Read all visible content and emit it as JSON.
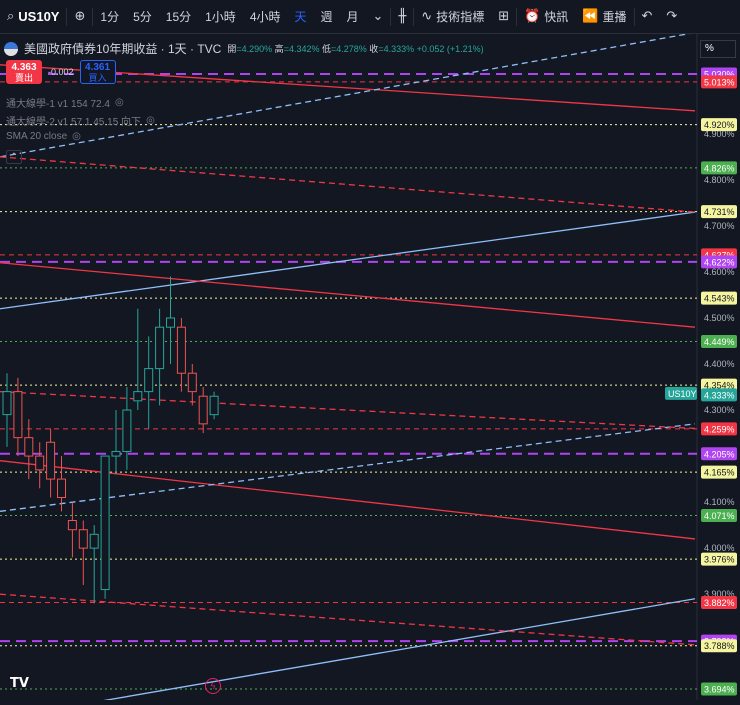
{
  "toolbar": {
    "symbol": "US10Y",
    "intervals": [
      "1分",
      "5分",
      "15分",
      "1小時",
      "4小時",
      "天",
      "週",
      "月"
    ],
    "active_interval": "天",
    "indicators_label": "技術指標",
    "alerts_label": "快訊",
    "replay_label": "重播"
  },
  "legend": {
    "title": "美國政府債券10年期收益 · 1天 · TVC",
    "open_label": "開",
    "open": "=4.290%",
    "high_label": "高",
    "high": "=4.342%",
    "low_label": "低",
    "low": "=4.278%",
    "close_label": "收",
    "close": "=4.333%",
    "change": "+0.052 (+1.21%)"
  },
  "trade": {
    "sell_price": "4.363",
    "sell_label": "賣出",
    "spread": "-0.002",
    "buy_price": "4.361",
    "buy_label": "買入"
  },
  "indicators": [
    {
      "name": "通大線學-1 v1 154 72.4"
    },
    {
      "name": "通大線學-2 v1 57.1 45.15 向下"
    },
    {
      "name": "SMA 20 close"
    }
  ],
  "scale_mode": "%",
  "symbol_tag": "US10Y",
  "colors": {
    "bg": "#131722",
    "up": "#26a69a",
    "down": "#ef5350",
    "red": "#f23645",
    "blue": "#90bff9",
    "purple": "#b044f0",
    "yellow": "#f5f5a0",
    "green": "#4caf50"
  },
  "chart_data": {
    "type": "candlestick",
    "y_range": [
      3.66,
      5.08
    ],
    "y_ticks": [
      "4.900%",
      "4.800%",
      "4.700%",
      "4.600%",
      "4.500%",
      "4.400%",
      "4.300%",
      "4.200%",
      "4.100%",
      "4.000%",
      "3.900%"
    ],
    "h_levels": [
      {
        "label": "5.030%",
        "value": 5.03,
        "color": "#b044f0",
        "bg": "#b044f0",
        "style": "dash-long"
      },
      {
        "label": "5.013%",
        "value": 5.013,
        "color": "#f23645",
        "bg": "#f23645",
        "style": "dash"
      },
      {
        "label": "4.920%",
        "value": 4.92,
        "color": "#f5f5a0",
        "bg": "#f5f5a0",
        "style": "dot"
      },
      {
        "label": "4.826%",
        "value": 4.826,
        "color": "#4caf50",
        "bg": "#4caf50",
        "style": "dot"
      },
      {
        "label": "4.731%",
        "value": 4.731,
        "color": "#f5f5a0",
        "bg": "#f5f5a0",
        "style": "dot"
      },
      {
        "label": "4.637%",
        "value": 4.637,
        "color": "#f23645",
        "bg": "#f23645",
        "style": "dash"
      },
      {
        "label": "4.622%",
        "value": 4.622,
        "color": "#b044f0",
        "bg": "#b044f0",
        "style": "dash-long"
      },
      {
        "label": "4.543%",
        "value": 4.543,
        "color": "#f5f5a0",
        "bg": "#f5f5a0",
        "style": "dot"
      },
      {
        "label": "4.449%",
        "value": 4.449,
        "color": "#4caf50",
        "bg": "#4caf50",
        "style": "dot"
      },
      {
        "label": "4.354%",
        "value": 4.354,
        "color": "#f5f5a0",
        "bg": "#f5f5a0",
        "style": "dot"
      },
      {
        "label": "4.259%",
        "value": 4.259,
        "color": "#f23645",
        "bg": "#f23645",
        "style": "dash"
      },
      {
        "label": "4.205%",
        "value": 4.205,
        "color": "#b044f0",
        "bg": "#b044f0",
        "style": "dash-long"
      },
      {
        "label": "4.165%",
        "value": 4.165,
        "color": "#f5f5a0",
        "bg": "#f5f5a0",
        "style": "dot"
      },
      {
        "label": "4.071%",
        "value": 4.071,
        "color": "#4caf50",
        "bg": "#4caf50",
        "style": "dot"
      },
      {
        "label": "3.976%",
        "value": 3.976,
        "color": "#f5f5a0",
        "bg": "#f5f5a0",
        "style": "dot"
      },
      {
        "label": "3.882%",
        "value": 3.882,
        "color": "#f23645",
        "bg": "#f23645",
        "style": "dash"
      },
      {
        "label": "3.798%",
        "value": 3.798,
        "color": "#b044f0",
        "bg": "#b044f0",
        "style": "dash-long"
      },
      {
        "label": "3.788%",
        "value": 3.788,
        "color": "#f5f5a0",
        "bg": "#f5f5a0",
        "style": "dot"
      },
      {
        "label": "3.694%",
        "value": 3.694,
        "color": "#4caf50",
        "bg": "#4caf50",
        "style": "dot"
      }
    ],
    "current_price": {
      "label": "4.333%",
      "value": 4.333
    },
    "candles": [
      {
        "o": 4.29,
        "h": 4.38,
        "l": 4.22,
        "c": 4.34
      },
      {
        "o": 4.34,
        "h": 4.37,
        "l": 4.2,
        "c": 4.24
      },
      {
        "o": 4.24,
        "h": 4.28,
        "l": 4.15,
        "c": 4.2
      },
      {
        "o": 4.2,
        "h": 4.23,
        "l": 4.13,
        "c": 4.17
      },
      {
        "o": 4.23,
        "h": 4.26,
        "l": 4.11,
        "c": 4.15
      },
      {
        "o": 4.15,
        "h": 4.2,
        "l": 4.08,
        "c": 4.11
      },
      {
        "o": 4.06,
        "h": 4.1,
        "l": 3.98,
        "c": 4.04
      },
      {
        "o": 4.04,
        "h": 4.06,
        "l": 3.92,
        "c": 4.0
      },
      {
        "o": 4.0,
        "h": 4.05,
        "l": 3.88,
        "c": 4.03
      },
      {
        "o": 3.91,
        "h": 4.2,
        "l": 3.89,
        "c": 4.2
      },
      {
        "o": 4.2,
        "h": 4.3,
        "l": 4.16,
        "c": 4.21
      },
      {
        "o": 4.21,
        "h": 4.35,
        "l": 4.17,
        "c": 4.3
      },
      {
        "o": 4.32,
        "h": 4.52,
        "l": 4.3,
        "c": 4.34
      },
      {
        "o": 4.34,
        "h": 4.46,
        "l": 4.26,
        "c": 4.39
      },
      {
        "o": 4.39,
        "h": 4.52,
        "l": 4.31,
        "c": 4.48
      },
      {
        "o": 4.48,
        "h": 4.59,
        "l": 4.4,
        "c": 4.5
      },
      {
        "o": 4.48,
        "h": 4.5,
        "l": 4.34,
        "c": 4.38
      },
      {
        "o": 4.38,
        "h": 4.4,
        "l": 4.31,
        "c": 4.34
      },
      {
        "o": 4.33,
        "h": 4.35,
        "l": 4.25,
        "c": 4.27
      },
      {
        "o": 4.29,
        "h": 4.34,
        "l": 4.28,
        "c": 4.33
      }
    ],
    "trend_lines": [
      {
        "color": "#f23645",
        "style": "solid",
        "p1": [
          0,
          5.05
        ],
        "p2": [
          695,
          4.95
        ]
      },
      {
        "color": "#90bff9",
        "style": "solid",
        "p1": [
          0,
          4.52
        ],
        "p2": [
          695,
          4.73
        ]
      },
      {
        "color": "#f23645",
        "style": "solid",
        "p1": [
          0,
          4.62
        ],
        "p2": [
          695,
          4.48
        ]
      },
      {
        "color": "#f23645",
        "style": "solid",
        "p1": [
          0,
          4.19
        ],
        "p2": [
          695,
          4.02
        ]
      },
      {
        "color": "#90bff9",
        "style": "solid",
        "p1": [
          0,
          3.63
        ],
        "p2": [
          695,
          3.89
        ]
      },
      {
        "color": "#90bff9",
        "style": "dash",
        "p1": [
          0,
          4.85
        ],
        "p2": [
          695,
          5.12
        ]
      },
      {
        "color": "#90bff9",
        "style": "dash",
        "p1": [
          0,
          4.08
        ],
        "p2": [
          695,
          4.27
        ]
      },
      {
        "color": "#f23645",
        "style": "dash",
        "p1": [
          0,
          4.85
        ],
        "p2": [
          695,
          4.73
        ]
      },
      {
        "color": "#f23645",
        "style": "dash",
        "p1": [
          0,
          4.34
        ],
        "p2": [
          695,
          4.26
        ]
      },
      {
        "color": "#f23645",
        "style": "dash",
        "p1": [
          0,
          3.9
        ],
        "p2": [
          695,
          3.79
        ]
      }
    ]
  }
}
